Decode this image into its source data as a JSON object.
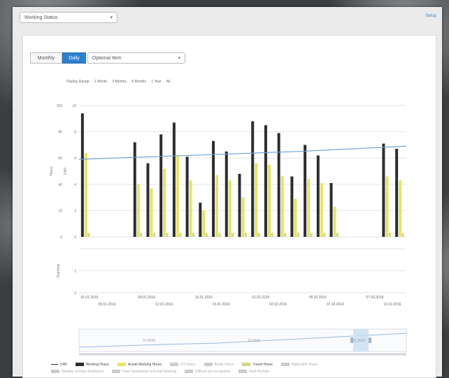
{
  "header": {
    "status_select": "Working Status",
    "top_link": "Setup"
  },
  "toolbar": {
    "monthly_label": "Monthly",
    "daily_label": "Daily",
    "optional_item": "Optional Item"
  },
  "range": {
    "label": "Display Range",
    "options": [
      "1 Month",
      "3 Months",
      "6 Months",
      "1 Year",
      "All"
    ]
  },
  "chart_data": {
    "type": "bar",
    "x_tick_labels_top": [
      "01.01.2016",
      "09.01.2016",
      "15.01.2016",
      "01.02.2016",
      "05.02.2016",
      "07.03.2016"
    ],
    "x_tick_labels_bottom": [
      "05.01.2016",
      "12.01.2016",
      "23.01.2016",
      "02.02.2016",
      "07.02.2016",
      "11.02.2016"
    ],
    "left_ticks": [
      "0",
      "20",
      "40",
      "60",
      "80",
      "100"
    ],
    "right_ticks": [
      "0",
      "2",
      "4",
      "6",
      "8",
      "10"
    ],
    "ylim": [
      0,
      10
    ],
    "series": [
      {
        "name": "Working Hours",
        "color": "#2b2d31",
        "values": [
          9.4,
          0,
          0,
          0,
          7.2,
          5.6,
          7.8,
          8.7,
          6.1,
          2.6,
          7.3,
          6.5,
          4.8,
          8.8,
          8.5,
          7.9,
          4.6,
          7.0,
          6.2,
          4.1,
          0,
          0,
          0,
          7.1,
          6.7
        ]
      },
      {
        "name": "Actual Working Hours",
        "color": "#e4e36a",
        "values": [
          6.4,
          0,
          0,
          0,
          4.0,
          3.7,
          5.2,
          6.2,
          4.3,
          2.0,
          4.7,
          4.3,
          3.0,
          5.6,
          5.5,
          4.6,
          2.9,
          4.4,
          4.1,
          2.3,
          0,
          0,
          0,
          4.6,
          4.3
        ]
      },
      {
        "name": "Travel Hours",
        "color": "#d6d58a",
        "values": [
          0.3,
          0,
          0,
          0,
          0.3,
          0.3,
          0.3,
          0.3,
          0.3,
          0.3,
          0.3,
          0.3,
          0.3,
          0.3,
          0.3,
          0.3,
          0.3,
          0.3,
          0.3,
          0.3,
          0,
          0,
          0,
          0.3,
          0.3
        ]
      }
    ],
    "trend": {
      "name": "UWI",
      "color": "#6fa3d6",
      "values": [
        5.9,
        6.2,
        6.5,
        6.9
      ]
    },
    "secondary_ylim": [
      0,
      2
    ],
    "secondary_ticks": [
      "0",
      "1"
    ],
    "secondary_label": "Overtime",
    "left_label": "Hours",
    "right_label": "UWI"
  },
  "navigator": {
    "labels": [
      "07.2015",
      "10.2015",
      "01.2016"
    ]
  },
  "legend": {
    "row1": [
      {
        "label": "UWI",
        "type": "line",
        "color": "#333333"
      },
      {
        "label": "Working Hours",
        "color": "#2b2d31"
      },
      {
        "label": "Actual Working Hours",
        "color": "#e4e36a"
      },
      {
        "label": "OT Hours",
        "color": "#cccccc",
        "dim": true
      },
      {
        "label": "Break Hours",
        "color": "#cccccc",
        "dim": true
      },
      {
        "label": "Travel Hours",
        "color": "#d6d58a"
      },
      {
        "label": "Night-shift Hours",
        "color": "#cccccc",
        "dim": true
      }
    ],
    "row2": [
      {
        "label": "Number of Days Employed",
        "color": "#cccccc"
      },
      {
        "label": "Over Declaration in Actual Working",
        "color": "#cccccc"
      },
      {
        "label": "Difficult job occupation",
        "color": "#cccccc"
      },
      {
        "label": "Rest Periods",
        "color": "#cccccc"
      }
    ]
  }
}
